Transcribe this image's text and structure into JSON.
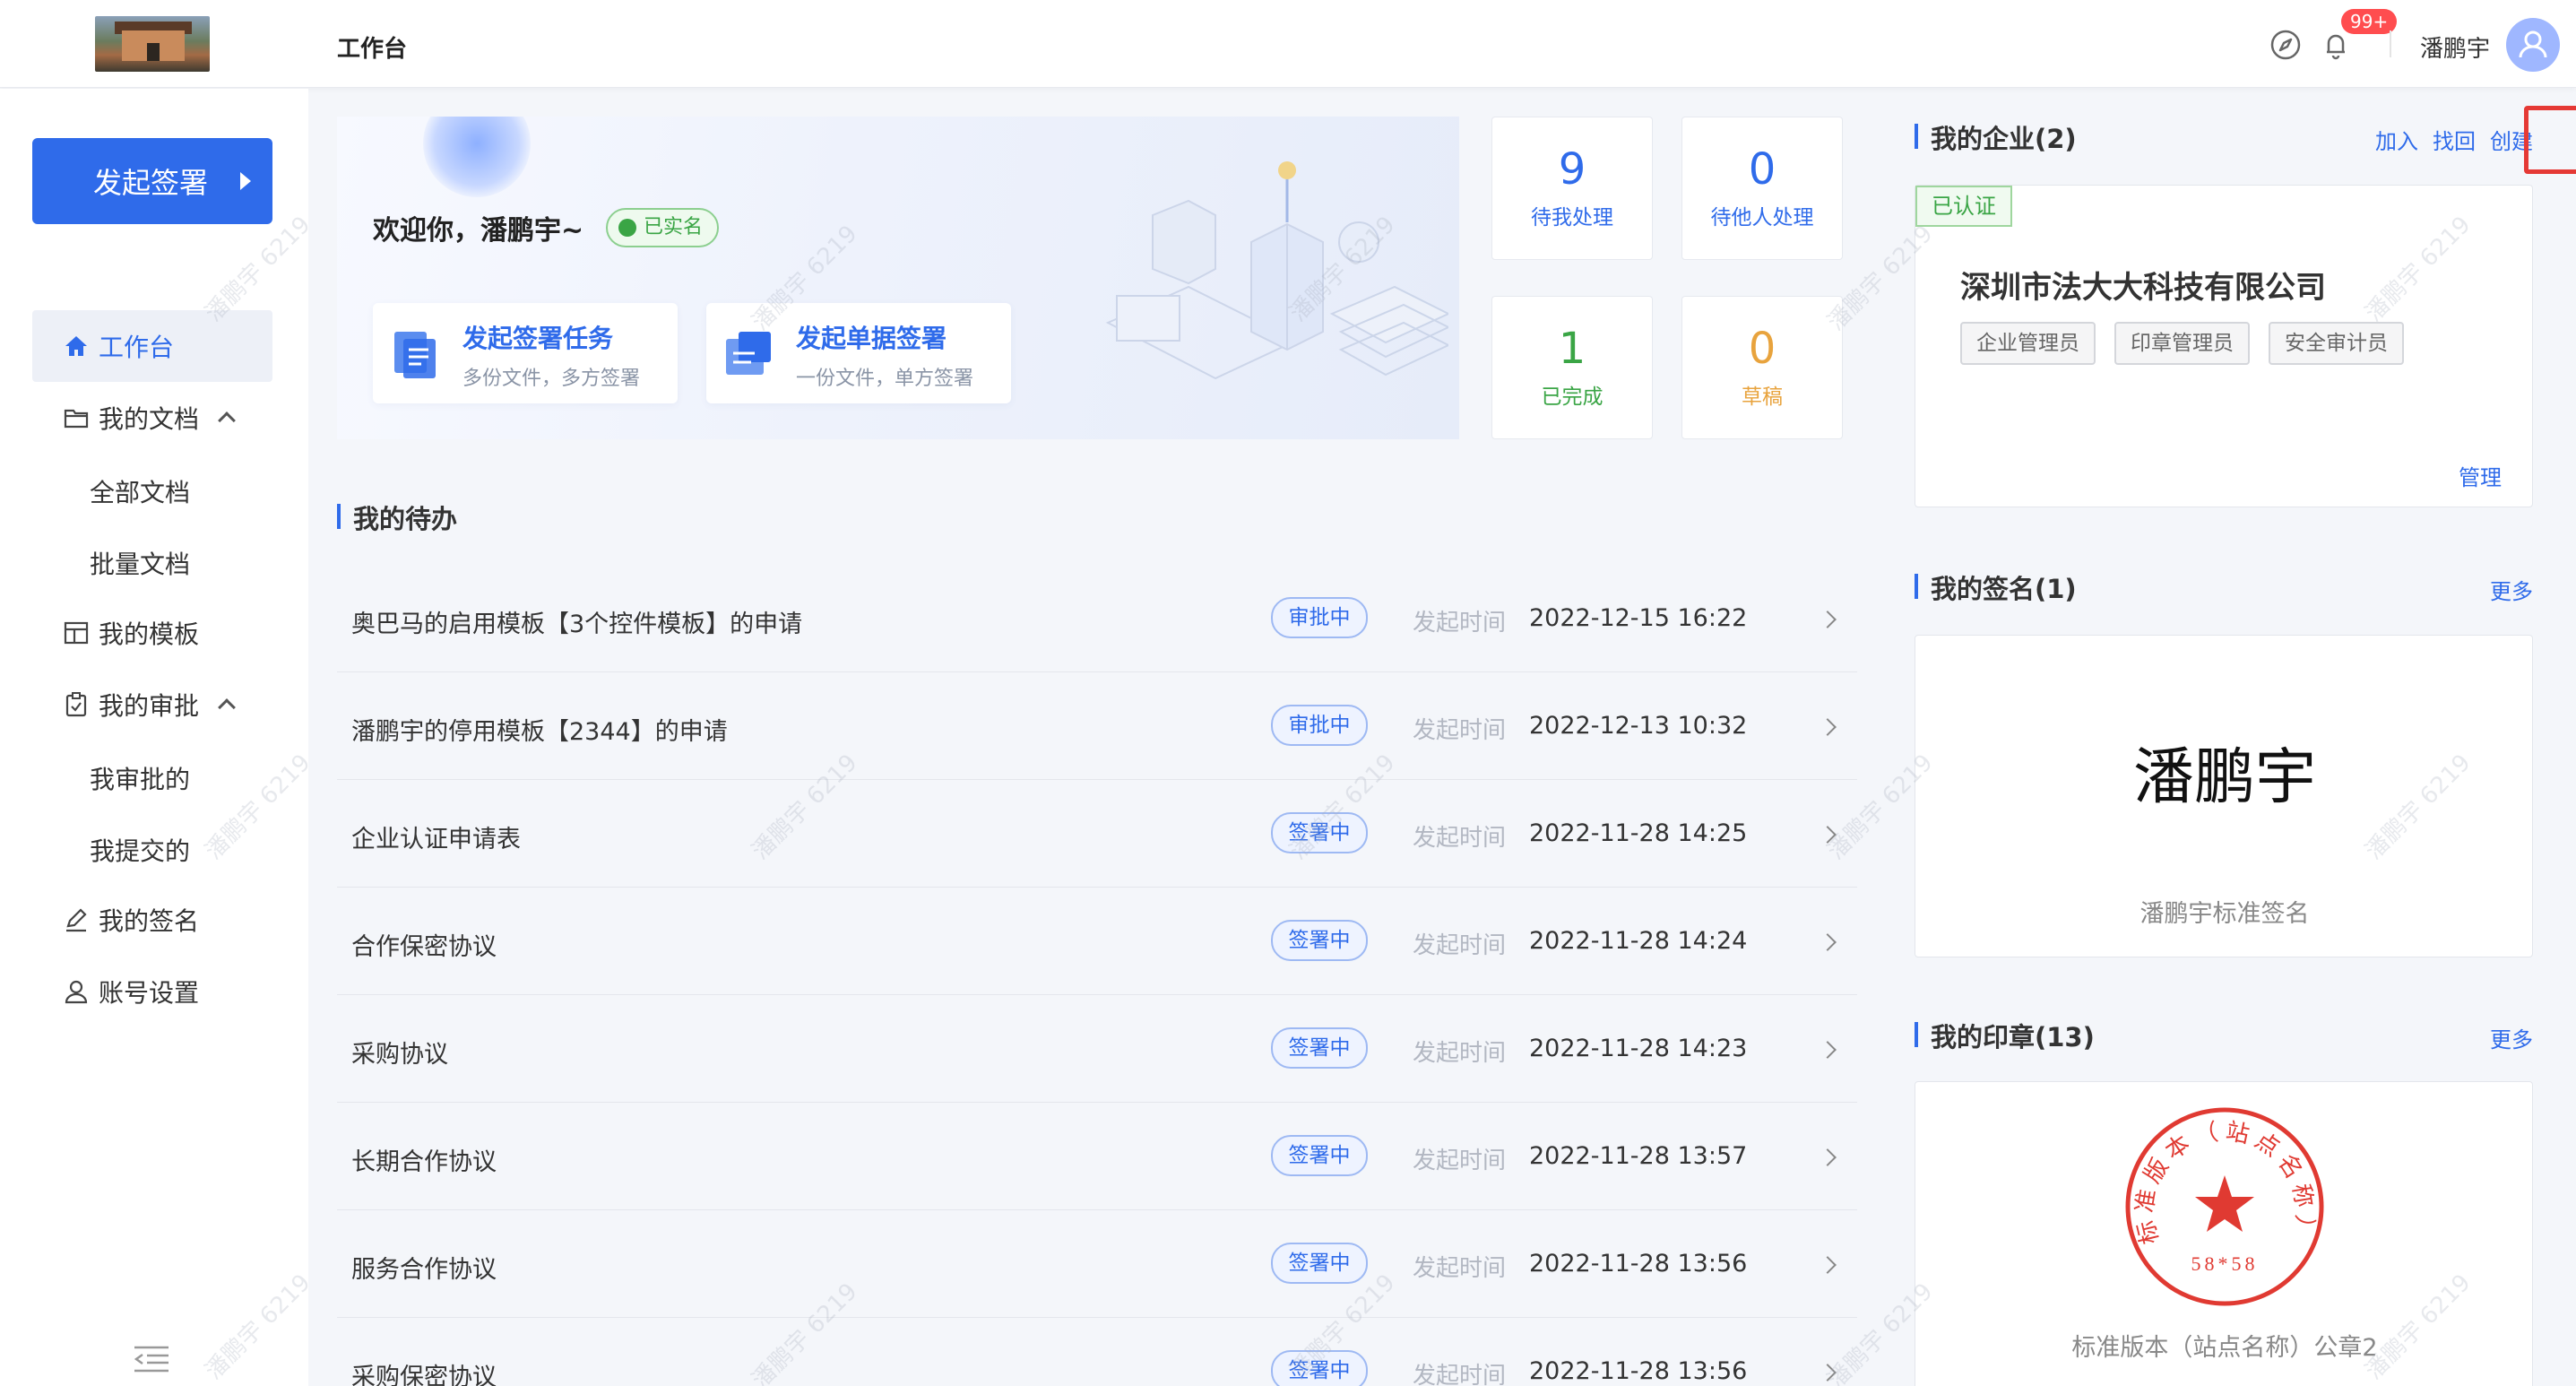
{
  "header": {
    "title": "工作台",
    "notification_count": "99+",
    "username": "潘鹏宇"
  },
  "sidebar": {
    "start_button": "发起签署",
    "items": [
      {
        "label": "工作台",
        "icon": "home-icon"
      },
      {
        "label": "我的文档",
        "icon": "folder-icon"
      },
      {
        "label": "全部文档"
      },
      {
        "label": "批量文档"
      },
      {
        "label": "我的模板",
        "icon": "template-icon"
      },
      {
        "label": "我的审批",
        "icon": "clipboard-icon"
      },
      {
        "label": "我审批的"
      },
      {
        "label": "我提交的"
      },
      {
        "label": "我的签名",
        "icon": "pen-icon"
      },
      {
        "label": "账号设置",
        "icon": "user-icon"
      }
    ]
  },
  "banner": {
    "welcome": "欢迎你，潘鹏宇~",
    "verified": "已实名",
    "cards": [
      {
        "title": "发起签署任务",
        "subtitle": "多份文件，多方签署"
      },
      {
        "title": "发起单据签署",
        "subtitle": "一份文件，单方签署"
      }
    ]
  },
  "stats": [
    {
      "value": "9",
      "label": "待我处理",
      "color": "#2f6bea"
    },
    {
      "value": "0",
      "label": "待他人处理",
      "color": "#2f6bea"
    },
    {
      "value": "1",
      "label": "已完成",
      "color": "#3aa545"
    },
    {
      "value": "0",
      "label": "草稿",
      "color": "#e8a33d"
    }
  ],
  "todo": {
    "title": "我的待办",
    "time_label": "发起时间",
    "rows": [
      {
        "title": "奥巴马的启用模板【3个控件模板】的申请",
        "status": "审批中",
        "time": "2022-12-15 16:22"
      },
      {
        "title": "潘鹏宇的停用模板【2344】的申请",
        "status": "审批中",
        "time": "2022-12-13 10:32"
      },
      {
        "title": "企业认证申请表",
        "status": "签署中",
        "time": "2022-11-28 14:25"
      },
      {
        "title": "合作保密协议",
        "status": "签署中",
        "time": "2022-11-28 14:24"
      },
      {
        "title": "采购协议",
        "status": "签署中",
        "time": "2022-11-28 14:23"
      },
      {
        "title": "长期合作协议",
        "status": "签署中",
        "time": "2022-11-28 13:57"
      },
      {
        "title": "服务合作协议",
        "status": "签署中",
        "time": "2022-11-28 13:56"
      },
      {
        "title": "采购保密协议",
        "status": "签署中",
        "time": "2022-11-28 13:56"
      }
    ]
  },
  "enterprise": {
    "title": "我的企业(2)",
    "join": "加入",
    "recover": "找回",
    "create": "创建",
    "cert_tag": "已认证",
    "company": "深圳市法大大科技有限公司",
    "roles": [
      "企业管理员",
      "印章管理员",
      "安全审计员"
    ],
    "manage": "管理"
  },
  "signature": {
    "title": "我的签名(1)",
    "more": "更多",
    "name": "潘鹏宇",
    "caption": "潘鹏宇标准签名"
  },
  "seal": {
    "title": "我的印章(13)",
    "more": "更多",
    "ring_text": "标准版本（站点名称）",
    "number": "58*58",
    "caption": "标准版本（站点名称）公章2"
  },
  "watermark": "潘鹏宇 6219"
}
